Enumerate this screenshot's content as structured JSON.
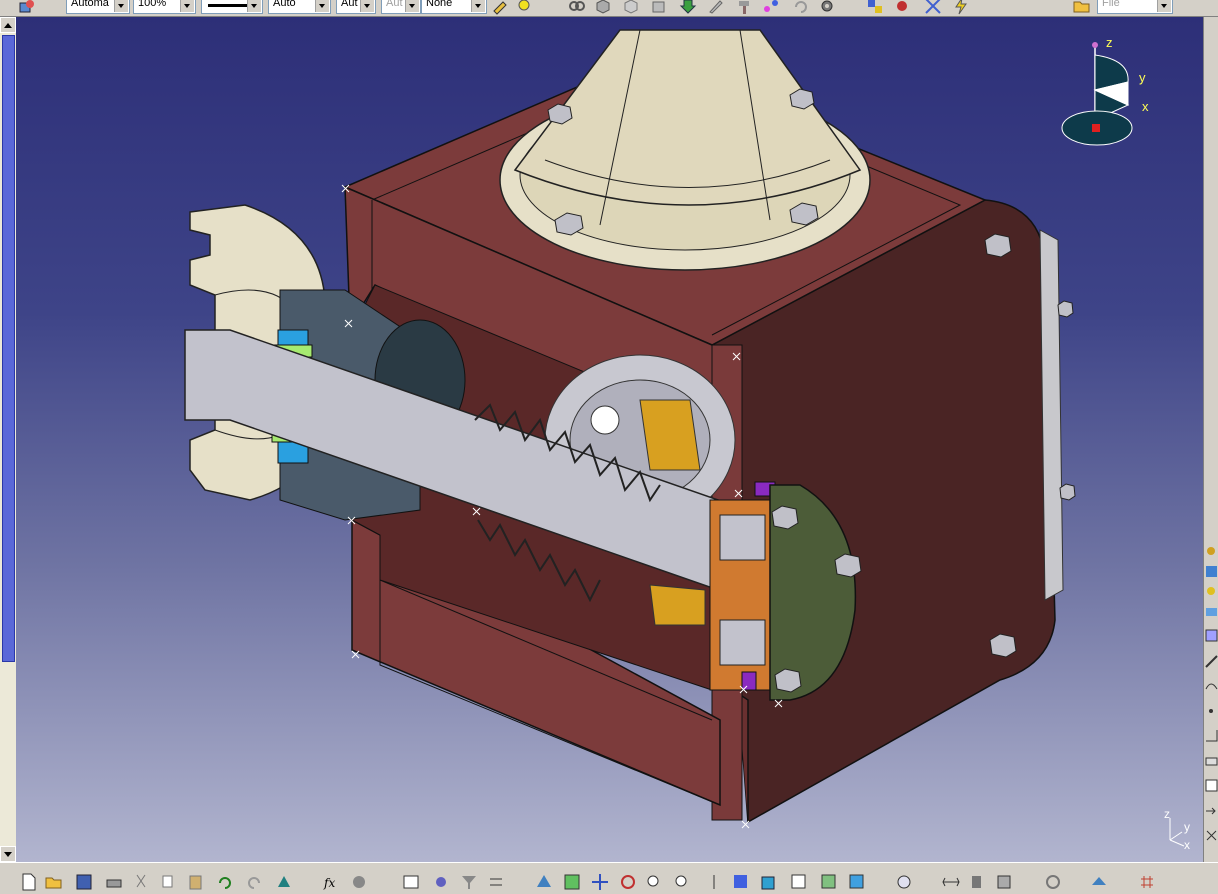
{
  "toolbar": {
    "zoom_mode": "Automa",
    "zoom_percent": "100%",
    "line_weight": "Auto",
    "layer": "Aut",
    "layer_disabled": "Aut",
    "pattern": "None",
    "file_filter": "File"
  },
  "compass": {
    "z": "z",
    "y": "y",
    "x": "x"
  },
  "axis_triad": {
    "z": "z",
    "y": "y",
    "x": "x"
  },
  "colors": {
    "housing": "#7c3b3b",
    "housing_dark": "#4a2020",
    "flange": "#e6e0c8",
    "shaft": "#c2c2cc",
    "seal_blue": "#2aa0e0",
    "seal_green": "#a6ea70",
    "bearing_orange": "#d07a30",
    "cover_green": "#4c5c38",
    "accent_purple": "#8a2ac0"
  }
}
